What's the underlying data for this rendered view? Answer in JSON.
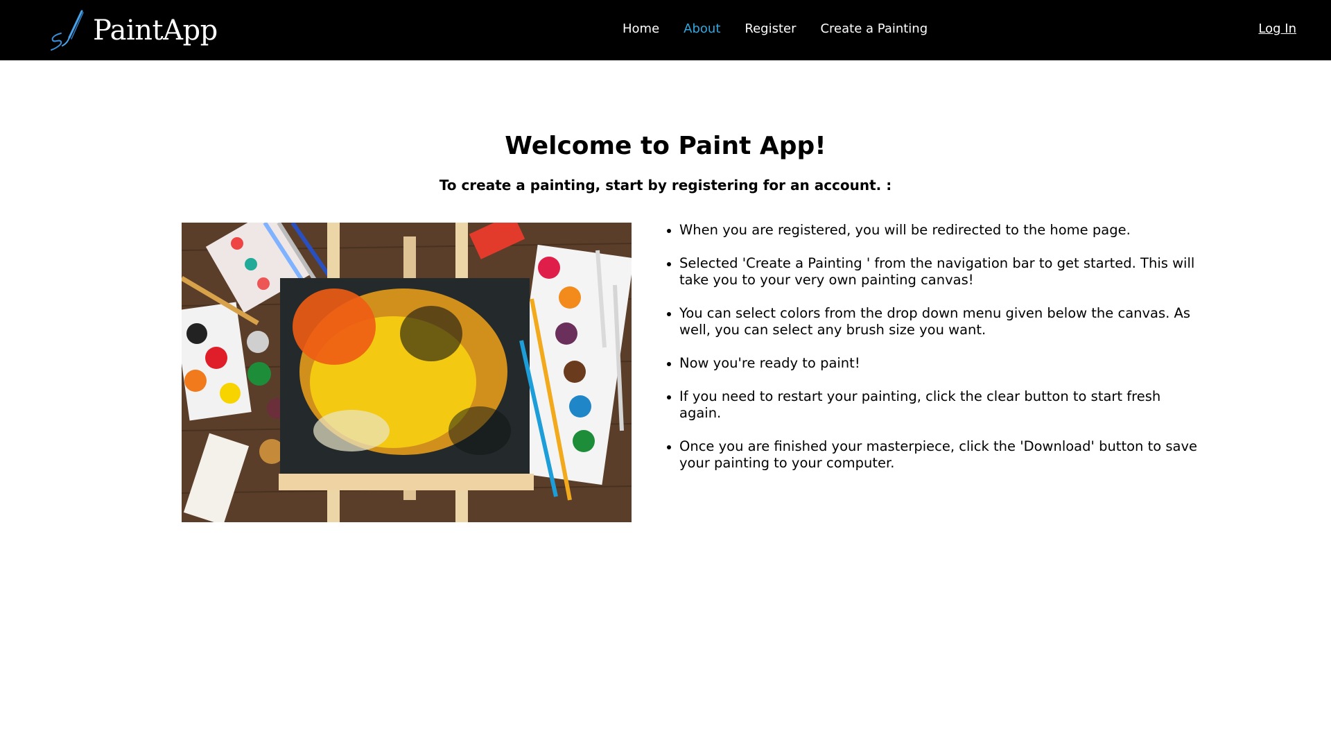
{
  "nav": {
    "brand": "PaintApp",
    "brand_icon": "paintbrush-icon",
    "links": [
      "Home",
      "About",
      "Register",
      "Create a Painting"
    ],
    "active_link": "About",
    "active_color": "#2fa8e0",
    "login": "Log In"
  },
  "main": {
    "title": "Welcome to Paint App!",
    "subtitle": "To create a painting, start by registering for an account. :",
    "image_icon": "painting-easel-image",
    "steps": [
      "When you are registered, you will be redirected to the home page.",
      "Selected 'Create a Painting ' from the navigation bar to get started. This will take you to your very own painting canvas!",
      "You can select colors from the drop down menu given below the canvas. As well, you can select any brush size you want.",
      "Now you're ready to paint!",
      "If you need to restart your painting, click the clear button to start fresh again.",
      "Once you are finished your masterpiece, click the 'Download' button to save your painting to your computer."
    ]
  }
}
